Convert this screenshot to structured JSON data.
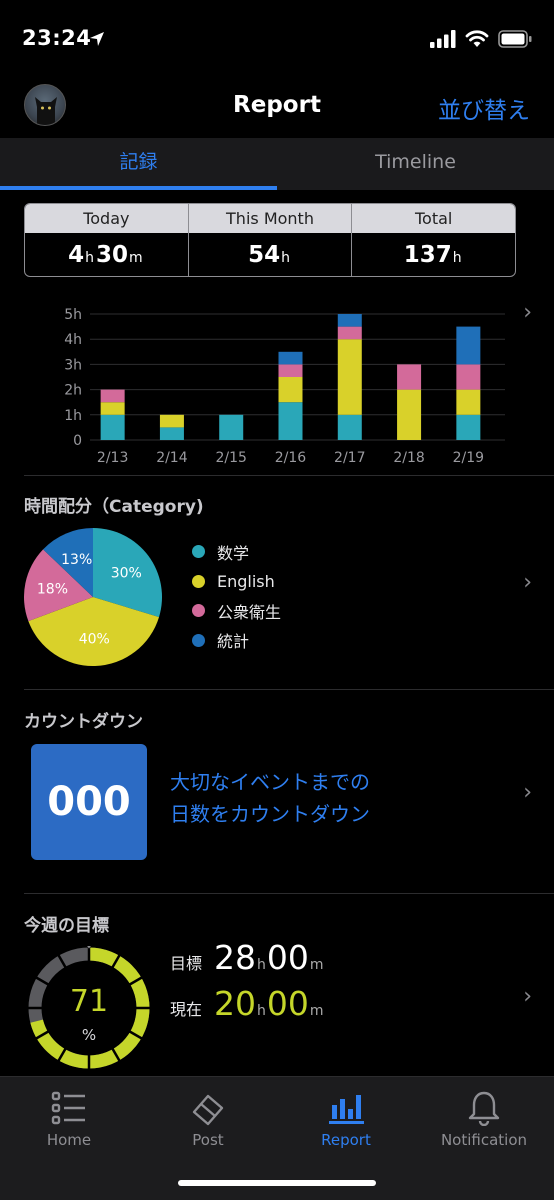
{
  "status_bar": {
    "time": "23:24"
  },
  "header": {
    "title": "Report",
    "sort_label": "並び替え"
  },
  "tabs": [
    {
      "label": "記録",
      "active": true
    },
    {
      "label": "Timeline",
      "active": false
    }
  ],
  "summary": [
    {
      "label": "Today",
      "hours": "4",
      "hours_unit": "h",
      "minutes": "30",
      "minutes_unit": "m"
    },
    {
      "label": "This Month",
      "hours": "54",
      "hours_unit": "h"
    },
    {
      "label": "Total",
      "hours": "137",
      "hours_unit": "h"
    }
  ],
  "chart_data": {
    "type": "bar",
    "stacked": true,
    "categories": [
      "2/13",
      "2/14",
      "2/15",
      "2/16",
      "2/17",
      "2/18",
      "2/19"
    ],
    "y_ticks": [
      "0",
      "1h",
      "2h",
      "3h",
      "4h",
      "5h"
    ],
    "ylim": [
      0,
      5
    ],
    "grid": true,
    "series": [
      {
        "name": "数学",
        "color": "#2aa7b8",
        "values": [
          1,
          0.5,
          1,
          1.5,
          1,
          0,
          1
        ]
      },
      {
        "name": "English",
        "color": "#d9d12a",
        "values": [
          0.5,
          0.5,
          0,
          1,
          3,
          2,
          1
        ]
      },
      {
        "name": "公衆衛生",
        "color": "#d36a9a",
        "values": [
          0.5,
          0,
          0,
          0.5,
          0.5,
          1,
          1
        ]
      },
      {
        "name": "統計",
        "color": "#1f6fb8",
        "values": [
          0,
          0,
          0,
          0.5,
          0.5,
          0,
          1.5
        ]
      }
    ]
  },
  "category_section": {
    "title": "時間配分（Category)",
    "pie": [
      {
        "name": "数学",
        "percent": 30,
        "label": "30%",
        "color": "#2aa7b8"
      },
      {
        "name": "English",
        "percent": 40,
        "label": "40%",
        "color": "#d9d12a"
      },
      {
        "name": "公衆衛生",
        "percent": 18,
        "label": "18%",
        "color": "#d36a9a"
      },
      {
        "name": "統計",
        "percent": 13,
        "label": "13%",
        "color": "#1f6fb8"
      }
    ]
  },
  "countdown": {
    "title": "カウントダウン",
    "value": "000",
    "line1": "大切なイベントまでの",
    "line2": "日数をカウントダウン"
  },
  "goal": {
    "title": "今週の目標",
    "percent": "71",
    "percent_unit": "%",
    "progress": 0.71,
    "target_label": "目標",
    "target_hours": "28",
    "target_minutes": "00",
    "current_label": "現在",
    "current_hours": "20",
    "current_minutes": "00",
    "h_unit": "h",
    "m_unit": "m",
    "accent": "#c5d62a"
  },
  "tab_bar": [
    {
      "label": "Home",
      "icon": "list-icon",
      "active": false
    },
    {
      "label": "Post",
      "icon": "eraser-icon",
      "active": false
    },
    {
      "label": "Report",
      "icon": "bar-chart-icon",
      "active": true
    },
    {
      "label": "Notification",
      "icon": "bell-icon",
      "active": false
    }
  ]
}
